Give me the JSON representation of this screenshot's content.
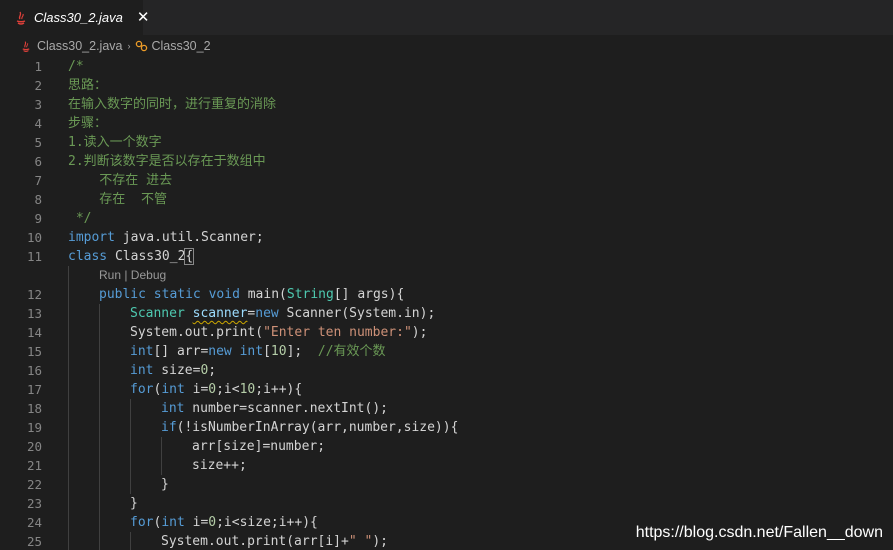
{
  "tab": {
    "label": "Class30_2.java",
    "close_glyph": "✕",
    "icon": "java-file-icon"
  },
  "breadcrumb": {
    "file": "Class30_2.java",
    "separator": "›",
    "symbol": "Class30_2"
  },
  "codelens": "Run | Debug",
  "lines": [
    {
      "n": "1",
      "indent": 0,
      "tokens": [
        [
          "/*",
          "c"
        ]
      ]
    },
    {
      "n": "2",
      "indent": 0,
      "tokens": [
        [
          "思路：",
          "c"
        ]
      ]
    },
    {
      "n": "3",
      "indent": 0,
      "tokens": [
        [
          "在输入数字的同时，进行重复的消除",
          "c"
        ]
      ]
    },
    {
      "n": "4",
      "indent": 0,
      "tokens": [
        [
          "步骤：",
          "c"
        ]
      ]
    },
    {
      "n": "5",
      "indent": 0,
      "tokens": [
        [
          "1.读入一个数字",
          "c"
        ]
      ]
    },
    {
      "n": "6",
      "indent": 0,
      "tokens": [
        [
          "2.判断该数字是否以存在于数组中",
          "c"
        ]
      ]
    },
    {
      "n": "7",
      "indent": 0,
      "tokens": [
        [
          "    不存在 进去",
          "c"
        ]
      ]
    },
    {
      "n": "8",
      "indent": 0,
      "tokens": [
        [
          "    存在  不管",
          "c"
        ]
      ]
    },
    {
      "n": "9",
      "indent": 0,
      "tokens": [
        [
          " */",
          "c"
        ]
      ]
    },
    {
      "n": "10",
      "indent": 0,
      "tokens": [
        [
          "import",
          "k"
        ],
        [
          " java.util.Scanner;",
          "p"
        ]
      ]
    },
    {
      "n": "11",
      "indent": 0,
      "tokens": [
        [
          "class",
          "k"
        ],
        [
          " Class30_2",
          "p"
        ],
        [
          "{",
          "b"
        ]
      ]
    },
    {
      "lens": true
    },
    {
      "n": "12",
      "indent": 1,
      "tokens": [
        [
          "public",
          "k"
        ],
        [
          " ",
          "p"
        ],
        [
          "static",
          "k"
        ],
        [
          " ",
          "p"
        ],
        [
          "void",
          "k"
        ],
        [
          " main(",
          "p"
        ],
        [
          "String",
          "t"
        ],
        [
          "[] args){",
          "p"
        ]
      ]
    },
    {
      "n": "13",
      "indent": 2,
      "tokens": [
        [
          "Scanner",
          "t"
        ],
        [
          " ",
          "p"
        ],
        [
          "scanner",
          "w"
        ],
        [
          "=",
          "p"
        ],
        [
          "new",
          "k"
        ],
        [
          " Scanner(System.in);",
          "p"
        ]
      ]
    },
    {
      "n": "14",
      "indent": 2,
      "tokens": [
        [
          "System.out.print(",
          "p"
        ],
        [
          "\"Enter ten number:\"",
          "s"
        ],
        [
          ");",
          "p"
        ]
      ]
    },
    {
      "n": "15",
      "indent": 2,
      "tokens": [
        [
          "int",
          "k"
        ],
        [
          "[] arr=",
          "p"
        ],
        [
          "new",
          "k"
        ],
        [
          " ",
          "p"
        ],
        [
          "int",
          "k"
        ],
        [
          "[",
          "p"
        ],
        [
          "10",
          "n"
        ],
        [
          "];  ",
          "p"
        ],
        [
          "//有效个数",
          "c"
        ]
      ]
    },
    {
      "n": "16",
      "indent": 2,
      "tokens": [
        [
          "int",
          "k"
        ],
        [
          " size=",
          "p"
        ],
        [
          "0",
          "n"
        ],
        [
          ";",
          "p"
        ]
      ]
    },
    {
      "n": "17",
      "indent": 2,
      "tokens": [
        [
          "for",
          "k"
        ],
        [
          "(",
          "p"
        ],
        [
          "int",
          "k"
        ],
        [
          " i=",
          "p"
        ],
        [
          "0",
          "n"
        ],
        [
          ";i<",
          "p"
        ],
        [
          "10",
          "n"
        ],
        [
          ";i++){",
          "p"
        ]
      ]
    },
    {
      "n": "18",
      "indent": 3,
      "tokens": [
        [
          "int",
          "k"
        ],
        [
          " number=scanner.nextInt();",
          "p"
        ]
      ]
    },
    {
      "n": "19",
      "indent": 3,
      "tokens": [
        [
          "if",
          "k"
        ],
        [
          "(!isNumberInArray(arr,number,size)){",
          "p"
        ]
      ]
    },
    {
      "n": "20",
      "indent": 4,
      "tokens": [
        [
          "arr[size]=number;",
          "p"
        ]
      ]
    },
    {
      "n": "21",
      "indent": 4,
      "tokens": [
        [
          "size++;",
          "p"
        ]
      ]
    },
    {
      "n": "22",
      "indent": 3,
      "tokens": [
        [
          "}",
          "p"
        ]
      ]
    },
    {
      "n": "23",
      "indent": 2,
      "tokens": [
        [
          "}",
          "p"
        ]
      ]
    },
    {
      "n": "24",
      "indent": 2,
      "tokens": [
        [
          "for",
          "k"
        ],
        [
          "(",
          "p"
        ],
        [
          "int",
          "k"
        ],
        [
          " i=",
          "p"
        ],
        [
          "0",
          "n"
        ],
        [
          ";i<size;i++){",
          "p"
        ]
      ]
    },
    {
      "n": "25",
      "indent": 3,
      "tokens": [
        [
          "System.out.print(arr[i]+",
          "p"
        ],
        [
          "\" \"",
          "s"
        ],
        [
          ");",
          "p"
        ]
      ]
    }
  ],
  "watermark": "https://blog.csdn.net/Fallen__down",
  "colors": {
    "background": "#1e1e1e",
    "comment": "#6a9955",
    "keyword": "#569cd6",
    "type": "#4ec9b0",
    "string": "#ce9178",
    "number": "#b5cea8",
    "line_number": "#858585"
  }
}
